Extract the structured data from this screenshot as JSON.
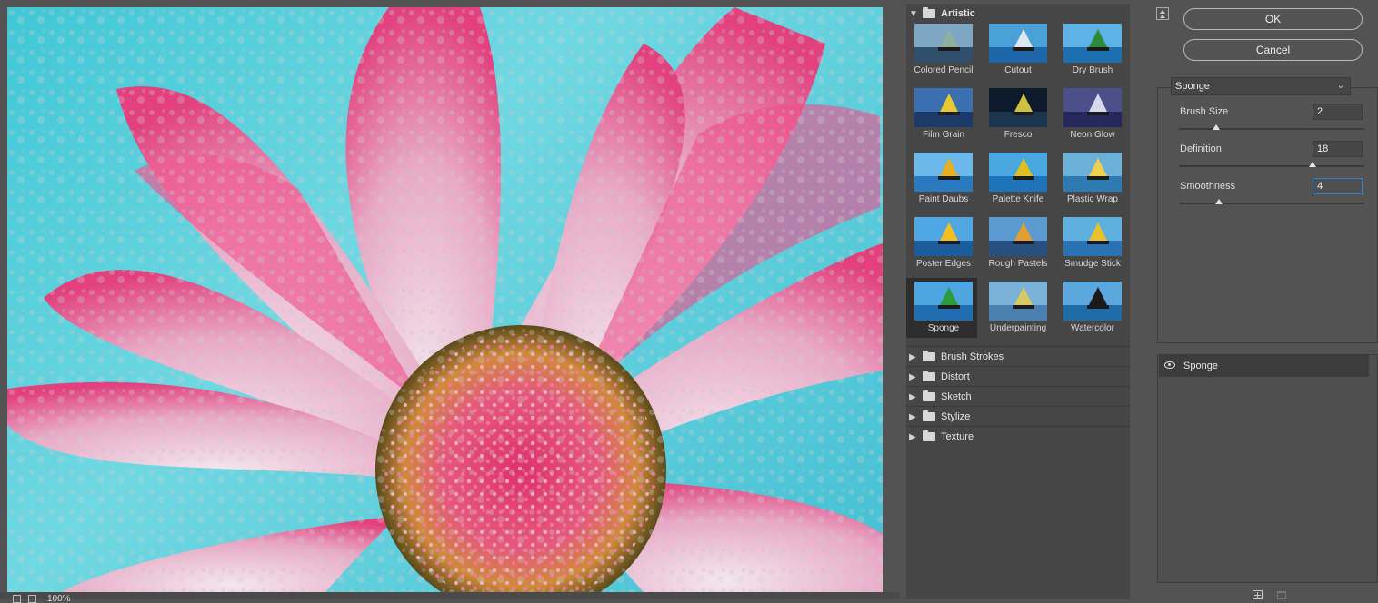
{
  "preview": {
    "zoom_level": "100%"
  },
  "gallery": {
    "open_category": "Artistic",
    "filters": [
      {
        "label": "Colored Pencil",
        "sky": "#7fa7c4",
        "sea": "#2f4f6a",
        "sail": "#8fb0a0"
      },
      {
        "label": "Cutout",
        "sky": "#4aa0d8",
        "sea": "#1d66a8",
        "sail": "#e0e8ef"
      },
      {
        "label": "Dry Brush",
        "sky": "#5db2e6",
        "sea": "#1d70b0",
        "sail": "#2d8a3a"
      },
      {
        "label": "Film Grain",
        "sky": "#3b6fb0",
        "sea": "#1b3a6a",
        "sail": "#e6c830"
      },
      {
        "label": "Fresco",
        "sky": "#0d1a2c",
        "sea": "#1a3550",
        "sail": "#d0c040"
      },
      {
        "label": "Neon Glow",
        "sky": "#4b4f8a",
        "sea": "#25285a",
        "sail": "#d8d8ef"
      },
      {
        "label": "Paint Daubs",
        "sky": "#6cb8ea",
        "sea": "#2a7ac0",
        "sail": "#e8b020"
      },
      {
        "label": "Palette Knife",
        "sky": "#4aa8e0",
        "sea": "#1f73b8",
        "sail": "#e0c020"
      },
      {
        "label": "Plastic Wrap",
        "sky": "#6cb2d8",
        "sea": "#2e7ab2",
        "sail": "#f0d050"
      },
      {
        "label": "Poster Edges",
        "sky": "#4fa8e4",
        "sea": "#1a5c9c",
        "sail": "#f0c020"
      },
      {
        "label": "Rough Pastels",
        "sky": "#5a9ad0",
        "sea": "#274f80",
        "sail": "#e0a030"
      },
      {
        "label": "Smudge Stick",
        "sky": "#5db0e0",
        "sea": "#2a72b4",
        "sail": "#e8c030"
      },
      {
        "label": "Sponge",
        "sky": "#4da6e0",
        "sea": "#1f6cb0",
        "sail": "#2d9a40"
      },
      {
        "label": "Underpainting",
        "sky": "#7ab2d8",
        "sea": "#4a80b0",
        "sail": "#d8c860"
      },
      {
        "label": "Watercolor",
        "sky": "#5aa8de",
        "sea": "#1e6ca8",
        "sail": "#1a1a1a"
      }
    ],
    "selected_filter": "Sponge",
    "categories": [
      "Brush Strokes",
      "Distort",
      "Sketch",
      "Stylize",
      "Texture"
    ]
  },
  "buttons": {
    "ok_label": "OK",
    "cancel_label": "Cancel"
  },
  "settings": {
    "filter_name": "Sponge",
    "params": [
      {
        "label": "Brush Size",
        "value": "2",
        "min": 0,
        "max": 10
      },
      {
        "label": "Definition",
        "value": "18",
        "min": 0,
        "max": 25
      },
      {
        "label": "Smoothness",
        "value": "4",
        "min": 1,
        "max": 15
      }
    ]
  },
  "layers": {
    "items": [
      {
        "name": "Sponge",
        "visible": true
      }
    ]
  },
  "colors": {
    "panel_bg": "#535353",
    "gallery_bg": "#464646",
    "selected_bg": "#2d2d2d",
    "focus_accent": "#2f7ed8"
  }
}
